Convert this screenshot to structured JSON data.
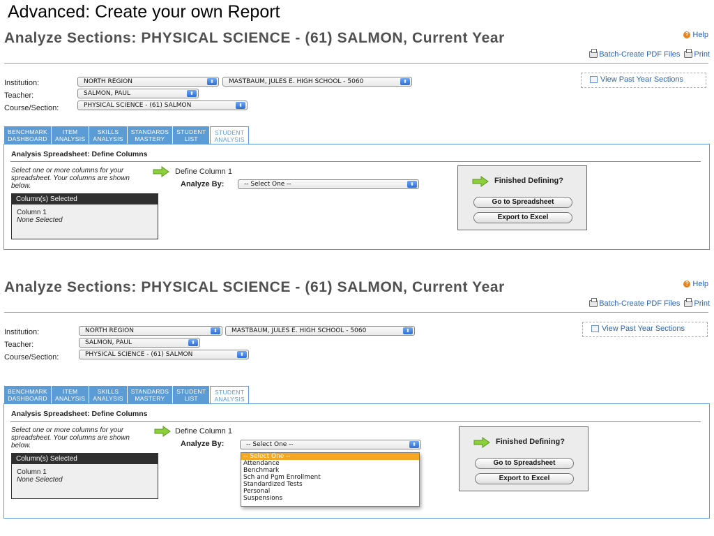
{
  "slide_title": "Advanced: Create your own Report",
  "page": {
    "title": "Analyze Sections: PHYSICAL SCIENCE - (61) SALMON, Current Year",
    "help": "Help",
    "batch_pdf": "Batch-Create PDF Files",
    "print": "Print",
    "view_past": "View Past Year Sections"
  },
  "filters": {
    "institution_label": "Institution:",
    "teacher_label": "Teacher:",
    "course_label": "Course/Section:",
    "region": "NORTH REGION",
    "school": "MASTBAUM, JULES E. HIGH SCHOOL - 5060",
    "teacher": "SALMON, PAUL",
    "course": "PHYSICAL SCIENCE - (61) SALMON"
  },
  "tabs": [
    {
      "line1": "BENCHMARK",
      "line2": "DASHBOARD"
    },
    {
      "line1": "ITEM",
      "line2": "ANALYSIS"
    },
    {
      "line1": "SKILLS",
      "line2": "ANALYSIS"
    },
    {
      "line1": "STANDARDS",
      "line2": "MASTERY"
    },
    {
      "line1": "STUDENT",
      "line2": "LIST"
    },
    {
      "line1": "STUDENT",
      "line2": "ANALYSIS"
    }
  ],
  "work": {
    "heading": "Analysis Spreadsheet: Define Columns",
    "instructions": "Select one or more columns for your spreadsheet. Your columns are shown below.",
    "selected_header": "Column(s) Selected",
    "column_name": "Column 1",
    "column_value": "None Selected",
    "define_label": "Define Column 1",
    "analyze_label": "Analyze By:",
    "select_value": "-- Select One --",
    "finished": "Finished Defining?",
    "go_button": "Go to Spreadsheet",
    "export_button": "Export to Excel"
  },
  "dropdown_options": [
    "-- Select One --",
    "Attendance",
    "Benchmark",
    "Sch and Pgm Enrollment",
    "Standardized Tests",
    "Personal",
    "Suspensions"
  ]
}
